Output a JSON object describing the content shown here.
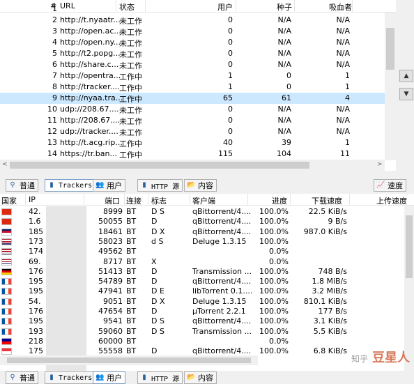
{
  "trackers": {
    "columns": {
      "num": "#",
      "url": "URL",
      "status": "状态",
      "users": "用户",
      "seeds": "种子",
      "leechers": "吸血者"
    },
    "rows": [
      {
        "num": "1",
        "url": "",
        "status": "",
        "users": "",
        "seeds": "",
        "leechers": ""
      },
      {
        "num": "2",
        "url": "http://t.nyaatr...",
        "status": "未工作",
        "users": "0",
        "seeds": "N/A",
        "leechers": "N/A"
      },
      {
        "num": "3",
        "url": "http://open.ac...",
        "status": "未工作",
        "users": "0",
        "seeds": "N/A",
        "leechers": "N/A"
      },
      {
        "num": "4",
        "url": "http://open.ny...",
        "status": "未工作",
        "users": "0",
        "seeds": "N/A",
        "leechers": "N/A"
      },
      {
        "num": "5",
        "url": "http://t2.popg...",
        "status": "未工作",
        "users": "0",
        "seeds": "N/A",
        "leechers": "N/A"
      },
      {
        "num": "6",
        "url": "http://share.c...",
        "status": "未工作",
        "users": "0",
        "seeds": "N/A",
        "leechers": "N/A"
      },
      {
        "num": "7",
        "url": "http://opentra...",
        "status": "工作中",
        "users": "1",
        "seeds": "0",
        "leechers": "1"
      },
      {
        "num": "8",
        "url": "http://tracker....",
        "status": "工作中",
        "users": "1",
        "seeds": "0",
        "leechers": "1"
      },
      {
        "num": "9",
        "url": "http://nyaa.tra...",
        "status": "工作中",
        "users": "65",
        "seeds": "61",
        "leechers": "4"
      },
      {
        "num": "10",
        "url": "udp://208.67....",
        "status": "未工作",
        "users": "0",
        "seeds": "N/A",
        "leechers": "N/A"
      },
      {
        "num": "11",
        "url": "http://208.67....",
        "status": "未工作",
        "users": "0",
        "seeds": "N/A",
        "leechers": "N/A"
      },
      {
        "num": "12",
        "url": "udp://tracker....",
        "status": "未工作",
        "users": "0",
        "seeds": "N/A",
        "leechers": "N/A"
      },
      {
        "num": "13",
        "url": "http://t.acg.rip...",
        "status": "工作中",
        "users": "40",
        "seeds": "39",
        "leechers": "1"
      },
      {
        "num": "14",
        "url": "https://tr.ban...",
        "status": "工作中",
        "users": "115",
        "seeds": "104",
        "leechers": "11"
      }
    ]
  },
  "tabs_top": {
    "general": "普通",
    "trackers": "Trackers",
    "peers": "用户",
    "http": "HTTP 源",
    "content": "内容",
    "speed": "速度"
  },
  "peers": {
    "columns": {
      "country": "国家",
      "ip": "IP",
      "port": "端口",
      "conn": "连接",
      "flags": "标志",
      "client": "客户端",
      "progress": "进度",
      "down": "下载速度",
      "up": "上传速度"
    },
    "rows": [
      {
        "flag": "hk",
        "ip": "42.",
        "port": "8999",
        "conn": "BT",
        "flags": "D S",
        "client": "qBittorrent/4....",
        "progress": "100.0%",
        "down": "22.5 KiB/s"
      },
      {
        "flag": "hk",
        "ip": "1.6",
        "port": "50055",
        "conn": "BT",
        "flags": "D",
        "client": "qBittorrent/4....",
        "progress": "100.0%",
        "down": "9 B/s"
      },
      {
        "flag": "gb",
        "ip": "185",
        "port": "18461",
        "conn": "BT",
        "flags": "D X",
        "client": "qBittorrent/4....",
        "progress": "100.0%",
        "down": "987.0 KiB/s"
      },
      {
        "flag": "us",
        "ip": "173",
        "port": "58023",
        "conn": "BT",
        "flags": "d S",
        "client": "Deluge 1.3.15",
        "progress": "100.0%",
        "down": ""
      },
      {
        "flag": "us",
        "ip": "174",
        "port": "49562",
        "conn": "BT",
        "flags": "",
        "client": "",
        "progress": "0.0%",
        "down": ""
      },
      {
        "flag": "us",
        "ip": "69.",
        "port": "8717",
        "conn": "BT",
        "flags": "X",
        "client": "",
        "progress": "0.0%",
        "down": ""
      },
      {
        "flag": "de",
        "ip": "176",
        "port": "51413",
        "conn": "BT",
        "flags": "D",
        "client": "Transmission ...",
        "progress": "100.0%",
        "down": "748 B/s"
      },
      {
        "flag": "fr",
        "ip": "195",
        "port": "54789",
        "conn": "BT",
        "flags": "D",
        "client": "qBittorrent/4....",
        "progress": "100.0%",
        "down": "1.8 MiB/s"
      },
      {
        "flag": "fr",
        "ip": "195",
        "port": "47941",
        "conn": "BT",
        "flags": "D E",
        "client": "libTorrent 0.1....",
        "progress": "100.0%",
        "down": "3.2 MiB/s"
      },
      {
        "flag": "fr",
        "ip": "54.",
        "port": "9051",
        "conn": "BT",
        "flags": "D X",
        "client": "Deluge 1.3.15",
        "progress": "100.0%",
        "down": "810.1 KiB/s"
      },
      {
        "flag": "fr",
        "ip": "176",
        "port": "47654",
        "conn": "BT",
        "flags": "D",
        "client": "µTorrent 2.2.1",
        "progress": "100.0%",
        "down": "177 B/s"
      },
      {
        "flag": "fr",
        "ip": "195",
        "port": "9541",
        "conn": "BT",
        "flags": "D S",
        "client": "qBittorrent/4....",
        "progress": "100.0%",
        "down": "3.1 KiB/s"
      },
      {
        "flag": "fr",
        "ip": "193",
        "port": "59060",
        "conn": "BT",
        "flags": "D S",
        "client": "Transmission ...",
        "progress": "100.0%",
        "down": "5.5 KiB/s"
      },
      {
        "flag": "tw",
        "ip": "218",
        "port": "60000",
        "conn": "BT",
        "flags": "",
        "client": "",
        "progress": "0.0%",
        "down": ""
      },
      {
        "flag": "sg",
        "ip": "175",
        "port": "55558",
        "conn": "BT",
        "flags": "D",
        "client": "qBittorrent/4....",
        "progress": "100.0%",
        "down": "6.8 KiB/s"
      }
    ]
  },
  "tabs_bottom": {
    "general": "普通",
    "trackers": "Trackers",
    "peers": "用户",
    "http": "HTTP 源",
    "content": "内容"
  },
  "watermark": {
    "site": "知乎",
    "brand": "豆星人"
  }
}
